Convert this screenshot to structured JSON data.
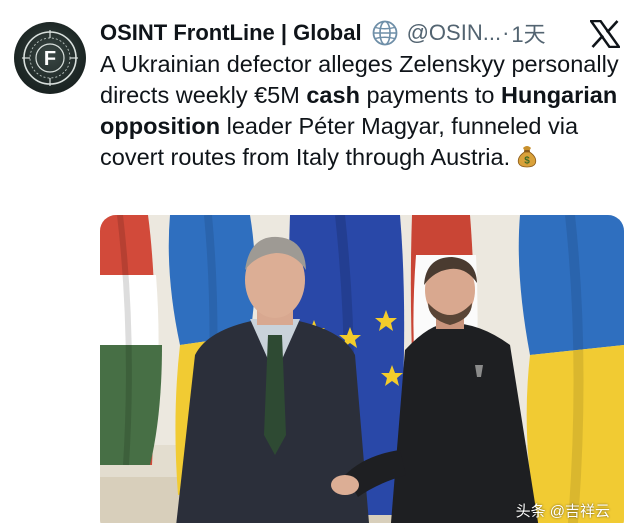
{
  "tweet": {
    "author_name": "OSINT FrontLine | Global",
    "handle": "@OSIN...",
    "dot": "·",
    "time": "1天",
    "avatar_letter": "F",
    "text_parts": {
      "p1": "A Ukrainian defector alleges Zelenskyy personally directs weekly €5M ",
      "b1": "cash",
      "p2": " payments to ",
      "b2": "Hungarian opposition",
      "p3": " leader Péter Magyar, funneled via covert routes from Italy through Austria."
    }
  },
  "icons": {
    "avatar": "osint-logo-avatar",
    "verified": "globe-icon",
    "platform": "x-logo-icon",
    "emoji": "money-bag-icon"
  },
  "colors": {
    "text": "#0f1419",
    "secondary": "#536471",
    "globe": "#6f8fa8"
  },
  "watermark": "头条 @吉祥云"
}
